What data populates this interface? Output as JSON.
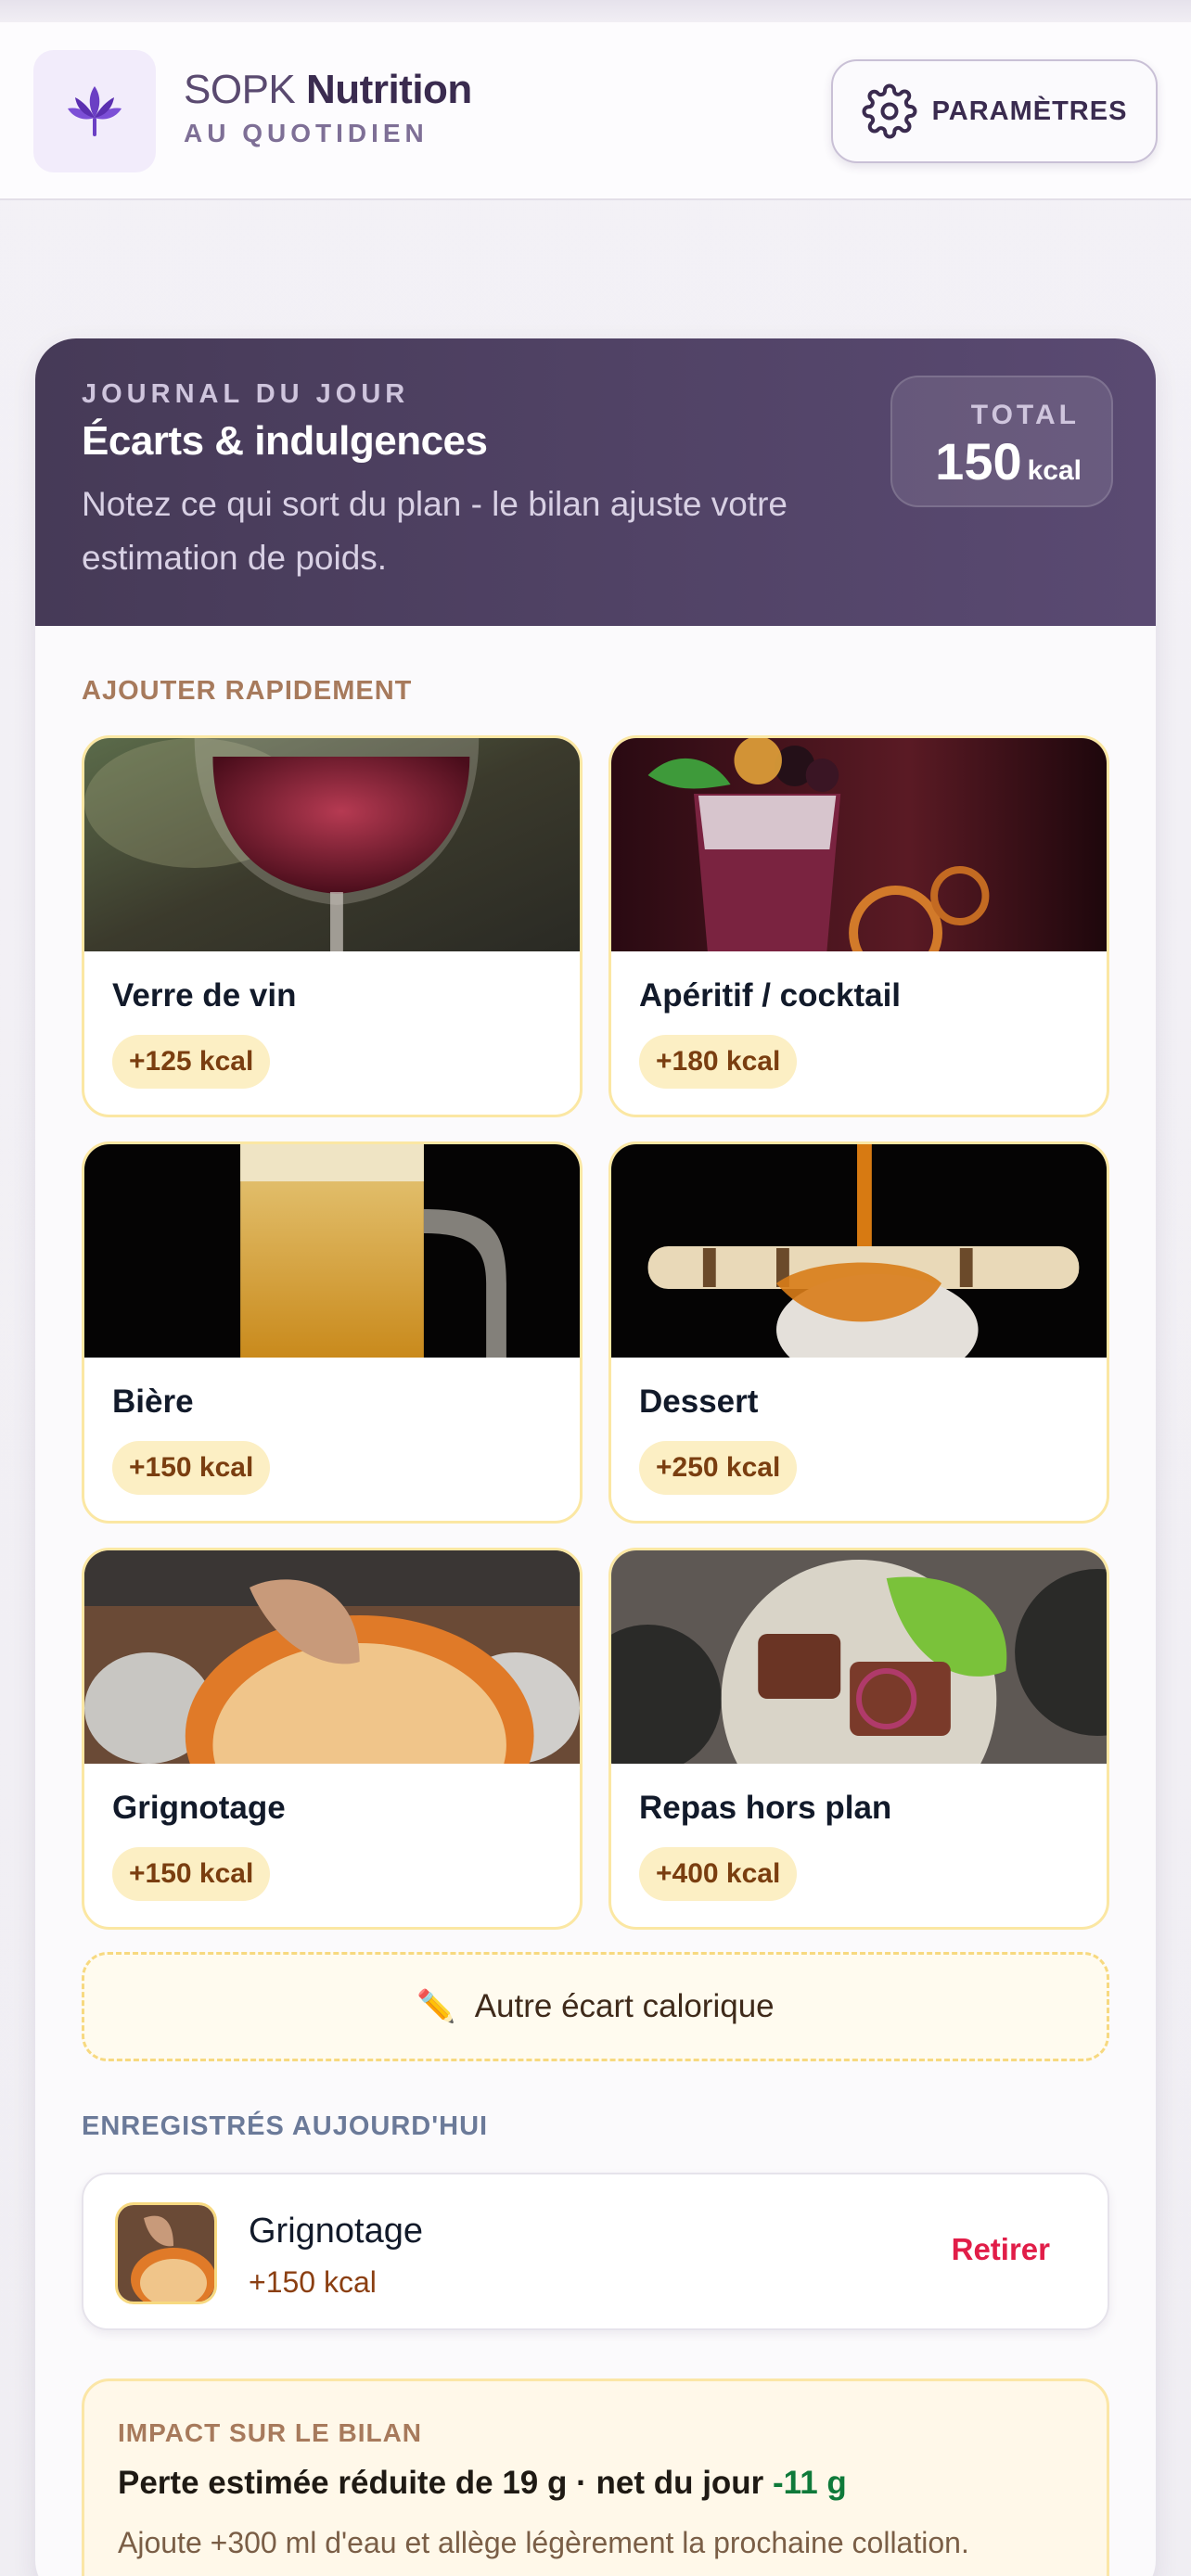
{
  "header": {
    "brand_light": "SOPK",
    "brand_bold": "Nutrition",
    "brand_subtitle": "AU QUOTIDIEN",
    "settings_label": "PARAMÈTRES",
    "logo_icon": "lotus-icon",
    "settings_icon": "gear-icon"
  },
  "journal": {
    "eyebrow": "JOURNAL DU JOUR",
    "title": "Écarts & indulgences",
    "description": "Notez ce qui sort du plan - le bilan ajuste votre estimation de poids.",
    "total_label": "TOTAL",
    "total_value": "150",
    "total_unit": "kcal"
  },
  "quick_add": {
    "label": "AJOUTER RAPIDEMENT",
    "items": [
      {
        "name": "Verre de vin",
        "kcal": "+125 kcal",
        "image": "red-wine-glass"
      },
      {
        "name": "Apéritif / cocktail",
        "kcal": "+180 kcal",
        "image": "berry-cocktail"
      },
      {
        "name": "Bière",
        "kcal": "+150 kcal",
        "image": "beer-mug"
      },
      {
        "name": "Dessert",
        "kcal": "+250 kcal",
        "image": "caramel-ice-cream"
      },
      {
        "name": "Grignotage",
        "kcal": "+150 kcal",
        "image": "chips-bowl"
      },
      {
        "name": "Repas hors plan",
        "kcal": "+400 kcal",
        "image": "steak-salad"
      }
    ],
    "other_label": "Autre écart calorique",
    "other_icon": "pencil-icon"
  },
  "saved": {
    "label": "ENREGISTRÉS AUJOURD'HUI",
    "items": [
      {
        "name": "Grignotage",
        "kcal": "+150 kcal",
        "remove_label": "Retirer"
      }
    ]
  },
  "impact": {
    "label": "IMPACT SUR LE BILAN",
    "main_text": "Perte estimée réduite de 19 g · net du jour ",
    "net_value": "-11 g",
    "note": "Ajoute +300 ml d'eau et allège légèrement la prochaine collation."
  },
  "colors": {
    "accent": "#5a4a72",
    "badge_bg": "#fcefc4",
    "badge_text": "#7a3e10",
    "remove": "#e11d48",
    "net_positive": "#0f7a3a"
  }
}
